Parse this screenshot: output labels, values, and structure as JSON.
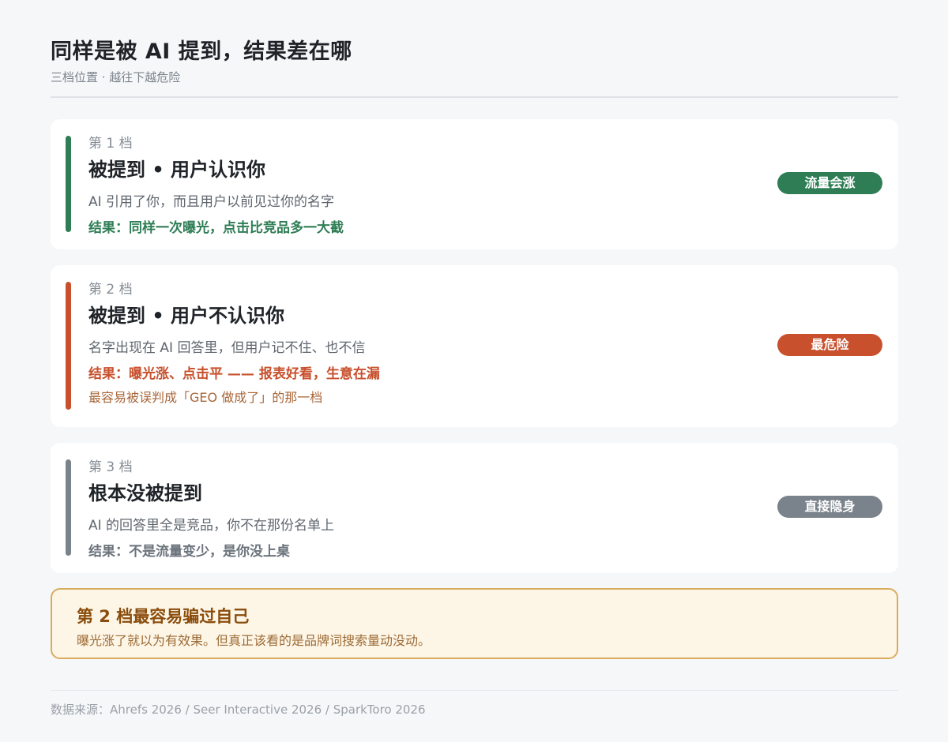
{
  "header": {
    "title": "同样是被 AI 提到，结果差在哪",
    "subtitle": "三档位置 · 越往下越危险"
  },
  "tiers": [
    {
      "label": "第 1 档",
      "title": "被提到 • 用户认识你",
      "description": "AI 引用了你，而且用户以前见过你的名字",
      "result": "结果：同样一次曝光，点击比竞品多一大截",
      "note": "",
      "badge": "流量会涨",
      "accent_color": "#2e7d55"
    },
    {
      "label": "第 2 档",
      "title": "被提到 • 用户不认识你",
      "description": "名字出现在 AI 回答里，但用户记不住、也不信",
      "result": "结果：曝光涨、点击平 —— 报表好看，生意在漏",
      "note": "最容易被误判成「GEO 做成了」的那一档",
      "badge": "最危险",
      "accent_color": "#c8502d",
      "note_color": "#a8673a"
    },
    {
      "label": "第 3 档",
      "title": "根本没被提到",
      "description": "AI 的回答里全是竞品，你不在那份名单上",
      "result": "结果：不是流量变少，是你没上桌",
      "note": "",
      "badge": "直接隐身",
      "accent_color": "#7a828c"
    }
  ],
  "callout": {
    "title": "第 2 档最容易骗过自己",
    "text": "曝光涨了就以为有效果。但真正该看的是品牌词搜索量动没动。"
  },
  "footer": {
    "source": "数据来源：Ahrefs 2026 / Seer Interactive 2026 / SparkToro 2026"
  }
}
